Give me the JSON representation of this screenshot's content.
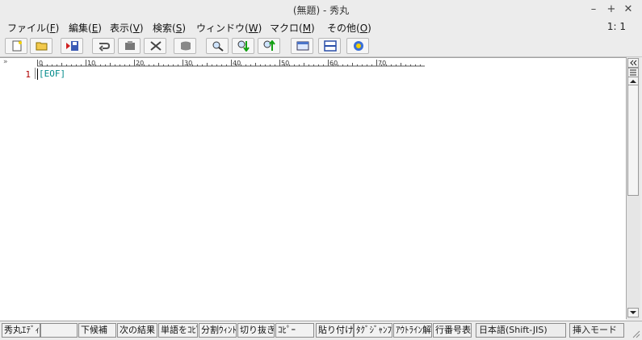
{
  "window": {
    "title": "(無題) - 秀丸",
    "minimize": "–",
    "maximize": "+",
    "close": "✕"
  },
  "menu": {
    "items": [
      {
        "label": "ファイル(",
        "key": "F",
        "suffix": ")"
      },
      {
        "label": "編集(",
        "key": "E",
        "suffix": ")"
      },
      {
        "label": "表示(",
        "key": "V",
        "suffix": ")"
      },
      {
        "label": "検索(",
        "key": "S",
        "suffix": ")"
      },
      {
        "label": "ウィンドウ(",
        "key": "W",
        "suffix": ")"
      },
      {
        "label": "マクロ(",
        "key": "M",
        "suffix": ")"
      },
      {
        "label": "その他(",
        "key": "O",
        "suffix": ")"
      }
    ],
    "cursor_position": "1: 1"
  },
  "toolbar": {
    "buttons": [
      {
        "name": "new-file-icon"
      },
      {
        "name": "open-folder-icon"
      },
      {
        "name": "save-icon"
      },
      {
        "name": "undo-icon"
      },
      {
        "name": "paste-icon"
      },
      {
        "name": "cut-icon"
      },
      {
        "name": "copy-icon"
      },
      {
        "name": "search-icon"
      },
      {
        "name": "search-down-icon"
      },
      {
        "name": "search-up-icon"
      },
      {
        "name": "window-list-icon"
      },
      {
        "name": "split-window-icon"
      },
      {
        "name": "help-icon"
      }
    ]
  },
  "editor": {
    "ruler_marker": "»",
    "ruler_labels": [
      "0",
      "10",
      "20",
      "30",
      "40",
      "50",
      "60",
      "70"
    ],
    "line_number": "1",
    "eof_text": "[EOF]"
  },
  "statusbar": {
    "fkeys": [
      "秀丸ｴﾃﾞｨ",
      "",
      "下候補",
      "次の結果",
      "単語をｺﾋﾟ",
      "分割ｳｨﾝﾄﾞ",
      "切り抜き",
      "ｺﾋﾟｰ",
      "貼り付け",
      "ﾀｸﾞｼﾞｬﾝﾌﾟ",
      "ｱｳﾄﾗｲﾝ解",
      "行番号表"
    ],
    "encoding": "日本語(Shift-JIS)",
    "mode": "挿入モード"
  }
}
